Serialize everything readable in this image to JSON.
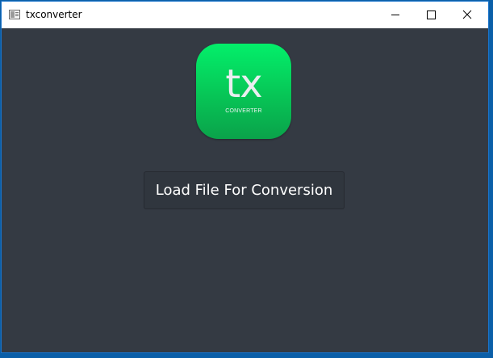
{
  "window": {
    "title": "txconverter"
  },
  "titlebar": {
    "icons": [
      "app-icon",
      "minimize-icon",
      "maximize-icon",
      "close-icon"
    ]
  },
  "logo": {
    "main_text": "tx",
    "sub_text": "CONVERTER",
    "color_top": "#03ef6a",
    "color_bottom": "#0aa24a"
  },
  "main": {
    "load_button_label": "Load File For Conversion"
  },
  "colors": {
    "background": "#343a43",
    "button_bg": "#30363e",
    "window_border": "#1a73c9"
  }
}
